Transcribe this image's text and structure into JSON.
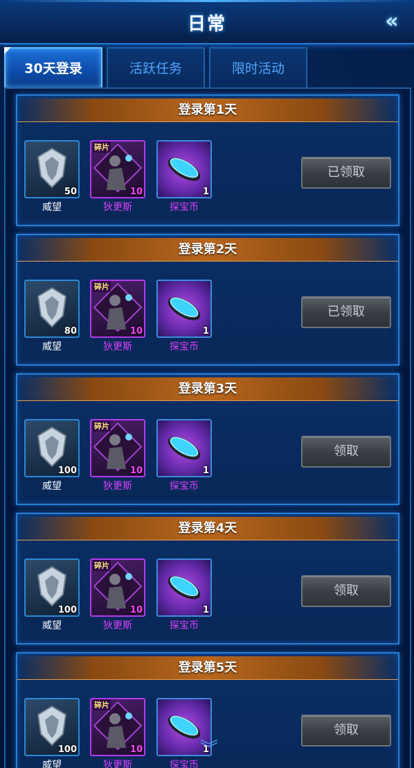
{
  "header": {
    "title": "日常",
    "back_icon": "«"
  },
  "tabs": [
    {
      "label": "30天登录",
      "active": true
    },
    {
      "label": "活跃任务",
      "active": false
    },
    {
      "label": "限时活动",
      "active": false
    }
  ],
  "cards": [
    {
      "title": "登录第1天",
      "items": [
        {
          "name": "威望",
          "count": "50"
        },
        {
          "name": "狄更斯",
          "count": "10",
          "tag": "碎片"
        },
        {
          "name": "探宝币",
          "count": "1"
        }
      ],
      "button": "已领取"
    },
    {
      "title": "登录第2天",
      "items": [
        {
          "name": "威望",
          "count": "80"
        },
        {
          "name": "狄更斯",
          "count": "10",
          "tag": "碎片"
        },
        {
          "name": "探宝币",
          "count": "1"
        }
      ],
      "button": "已领取"
    },
    {
      "title": "登录第3天",
      "items": [
        {
          "name": "威望",
          "count": "100"
        },
        {
          "name": "狄更斯",
          "count": "10",
          "tag": "碎片"
        },
        {
          "name": "探宝币",
          "count": "1"
        }
      ],
      "button": "领取"
    },
    {
      "title": "登录第4天",
      "items": [
        {
          "name": "威望",
          "count": "100"
        },
        {
          "name": "狄更斯",
          "count": "10",
          "tag": "碎片"
        },
        {
          "name": "探宝币",
          "count": "1"
        }
      ],
      "button": "领取"
    },
    {
      "title": "登录第5天",
      "items": [
        {
          "name": "威望",
          "count": "100"
        },
        {
          "name": "狄更斯",
          "count": "10",
          "tag": "碎片"
        },
        {
          "name": "探宝币",
          "count": "1"
        }
      ],
      "button": "领取"
    }
  ],
  "scroll_icon": "︾"
}
